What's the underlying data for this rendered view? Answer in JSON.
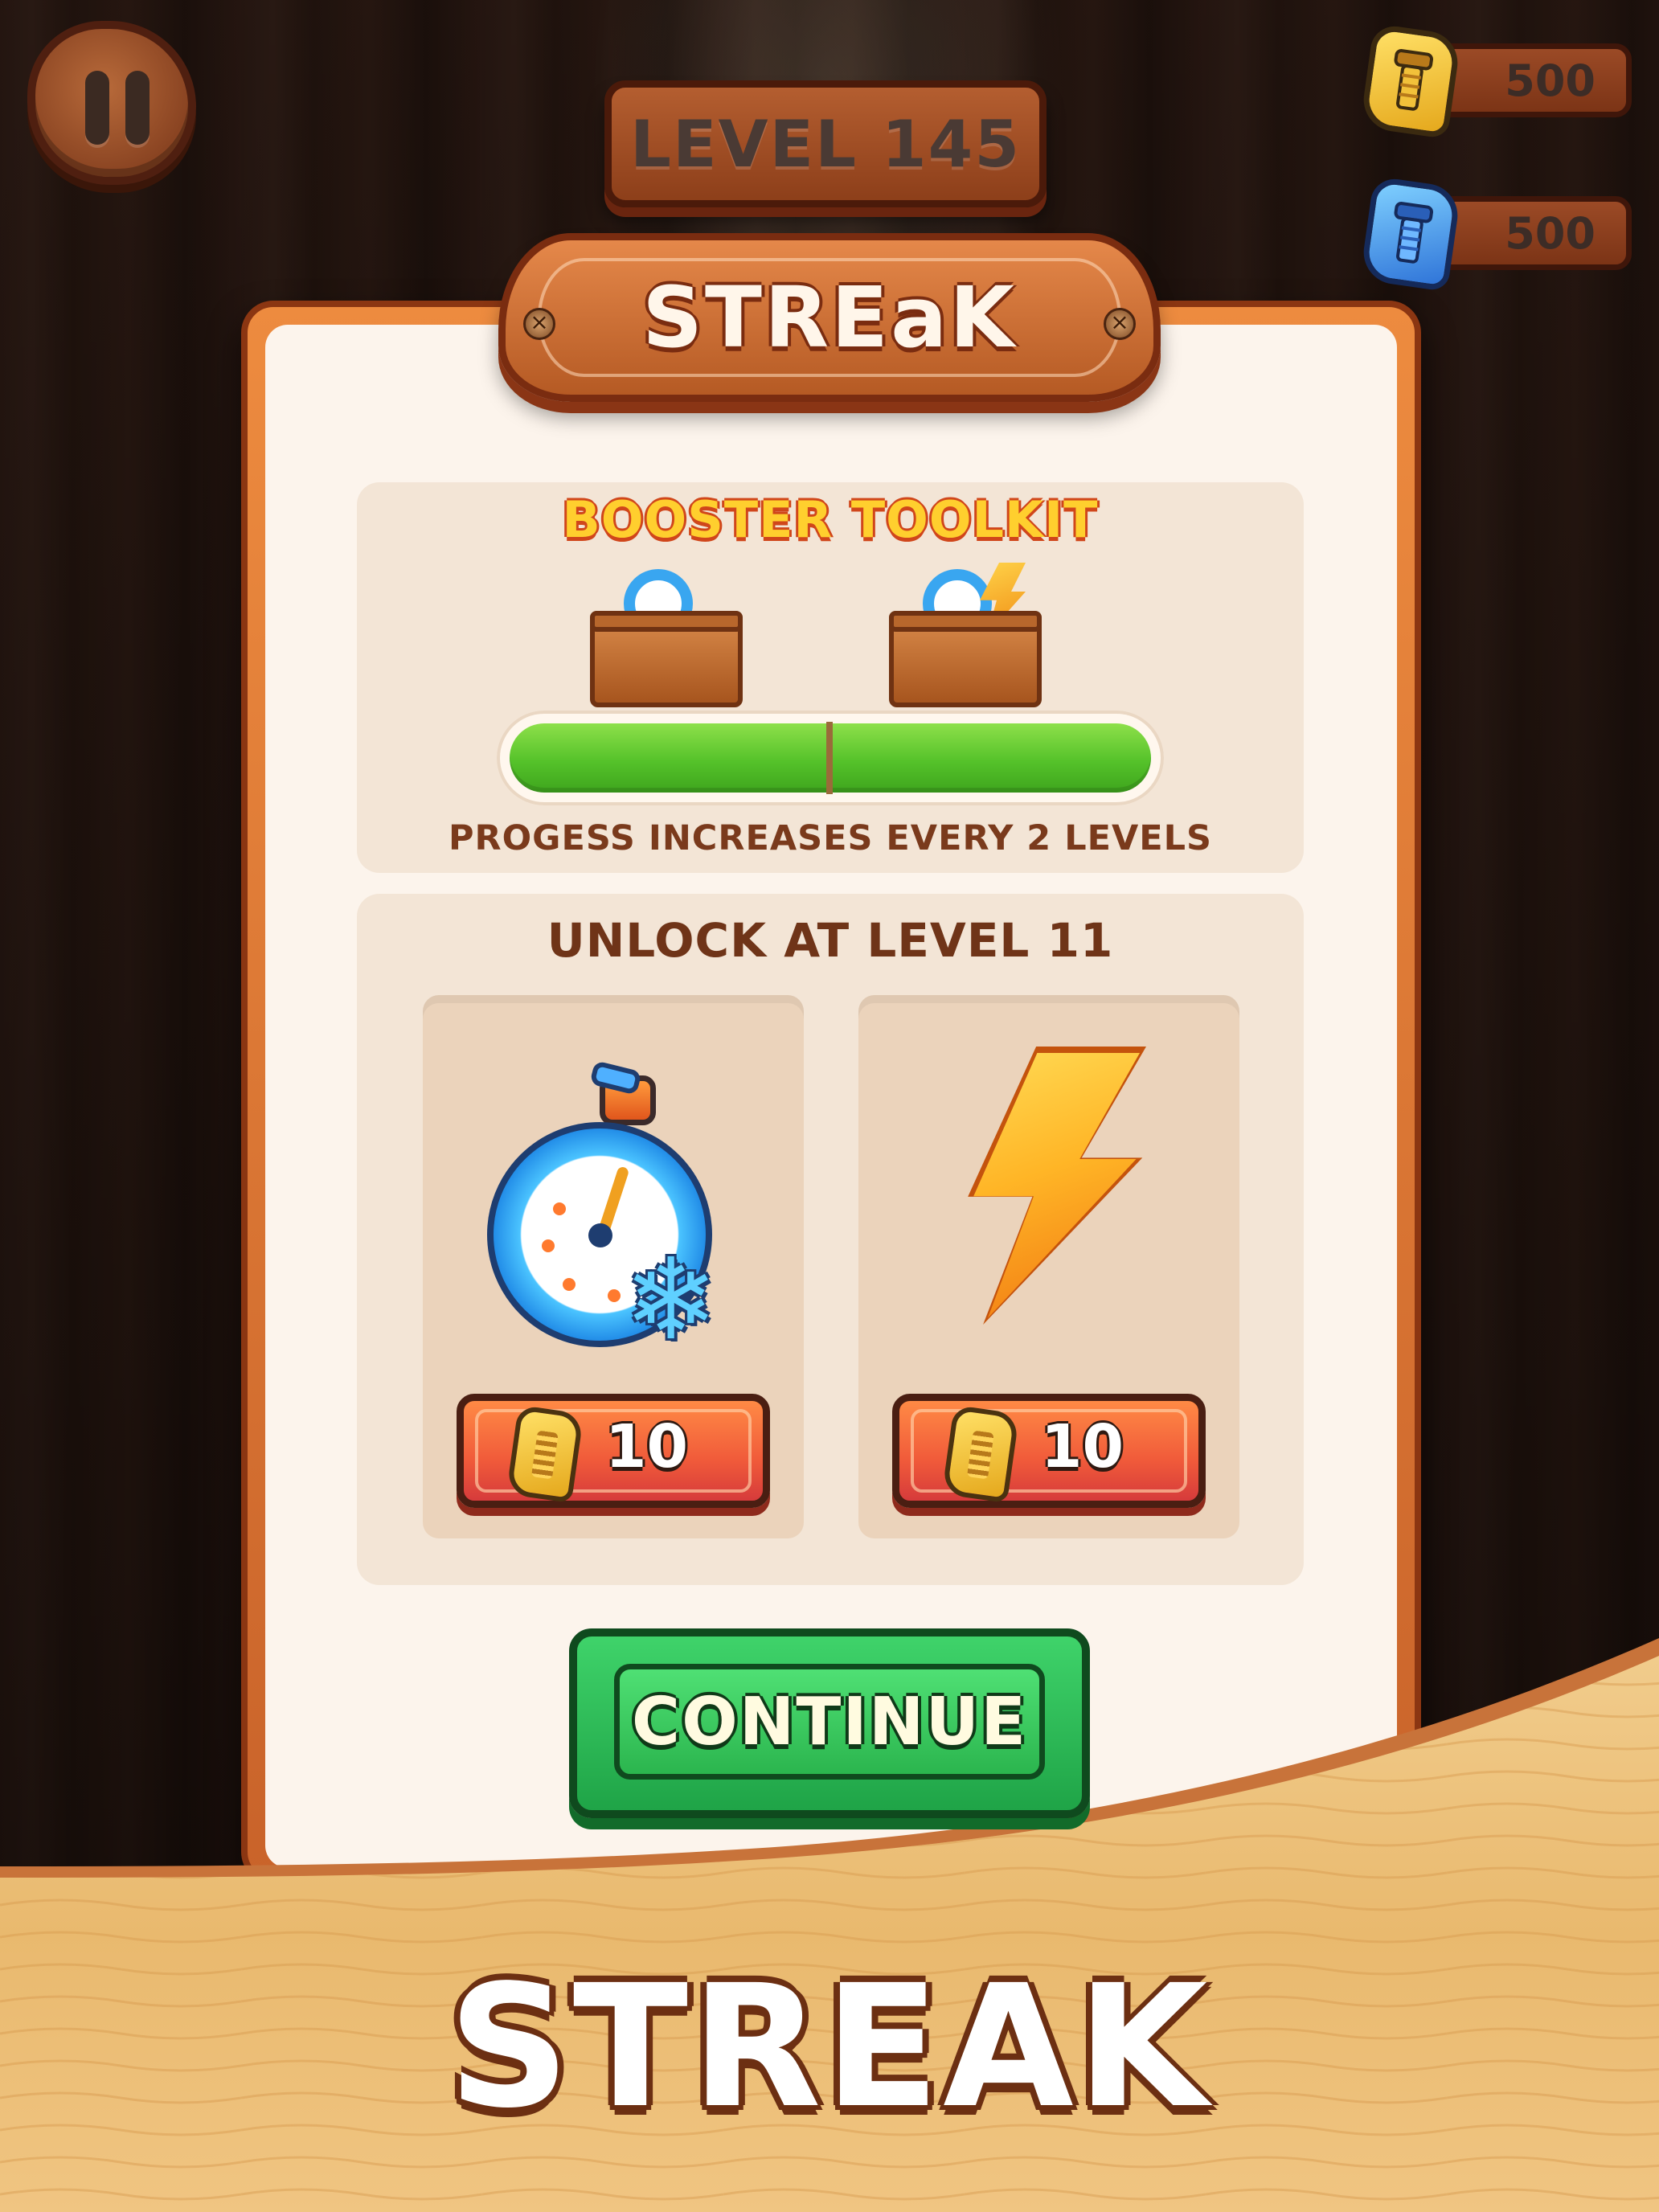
{
  "hud": {
    "level_label": "LEVEL 145",
    "currencies": [
      {
        "type": "gold-bolt",
        "amount": "500"
      },
      {
        "type": "blue-bolt",
        "amount": "500"
      }
    ]
  },
  "dialog": {
    "title": "STREaK",
    "toolkit": {
      "title": "BOOSTER TOOLKIT",
      "progress": 1.0,
      "note": "PROGESS INCREASES EVERY 2 LEVELS"
    },
    "unlock": {
      "title": "UNLOCK AT LEVEL 11",
      "boosters": [
        {
          "icon": "freeze-stopwatch-icon",
          "price": "10"
        },
        {
          "icon": "lightning-bolt-icon",
          "price": "10"
        }
      ]
    },
    "continue_label": "CONTINUE"
  },
  "banner": {
    "title": "STREAK"
  },
  "colors": {
    "panel": "#fcf4ec",
    "accent_orange": "#e5884a",
    "progress_green": "#55c22a",
    "continue_green": "#2bb54e",
    "price_red": "#f05a3a"
  }
}
